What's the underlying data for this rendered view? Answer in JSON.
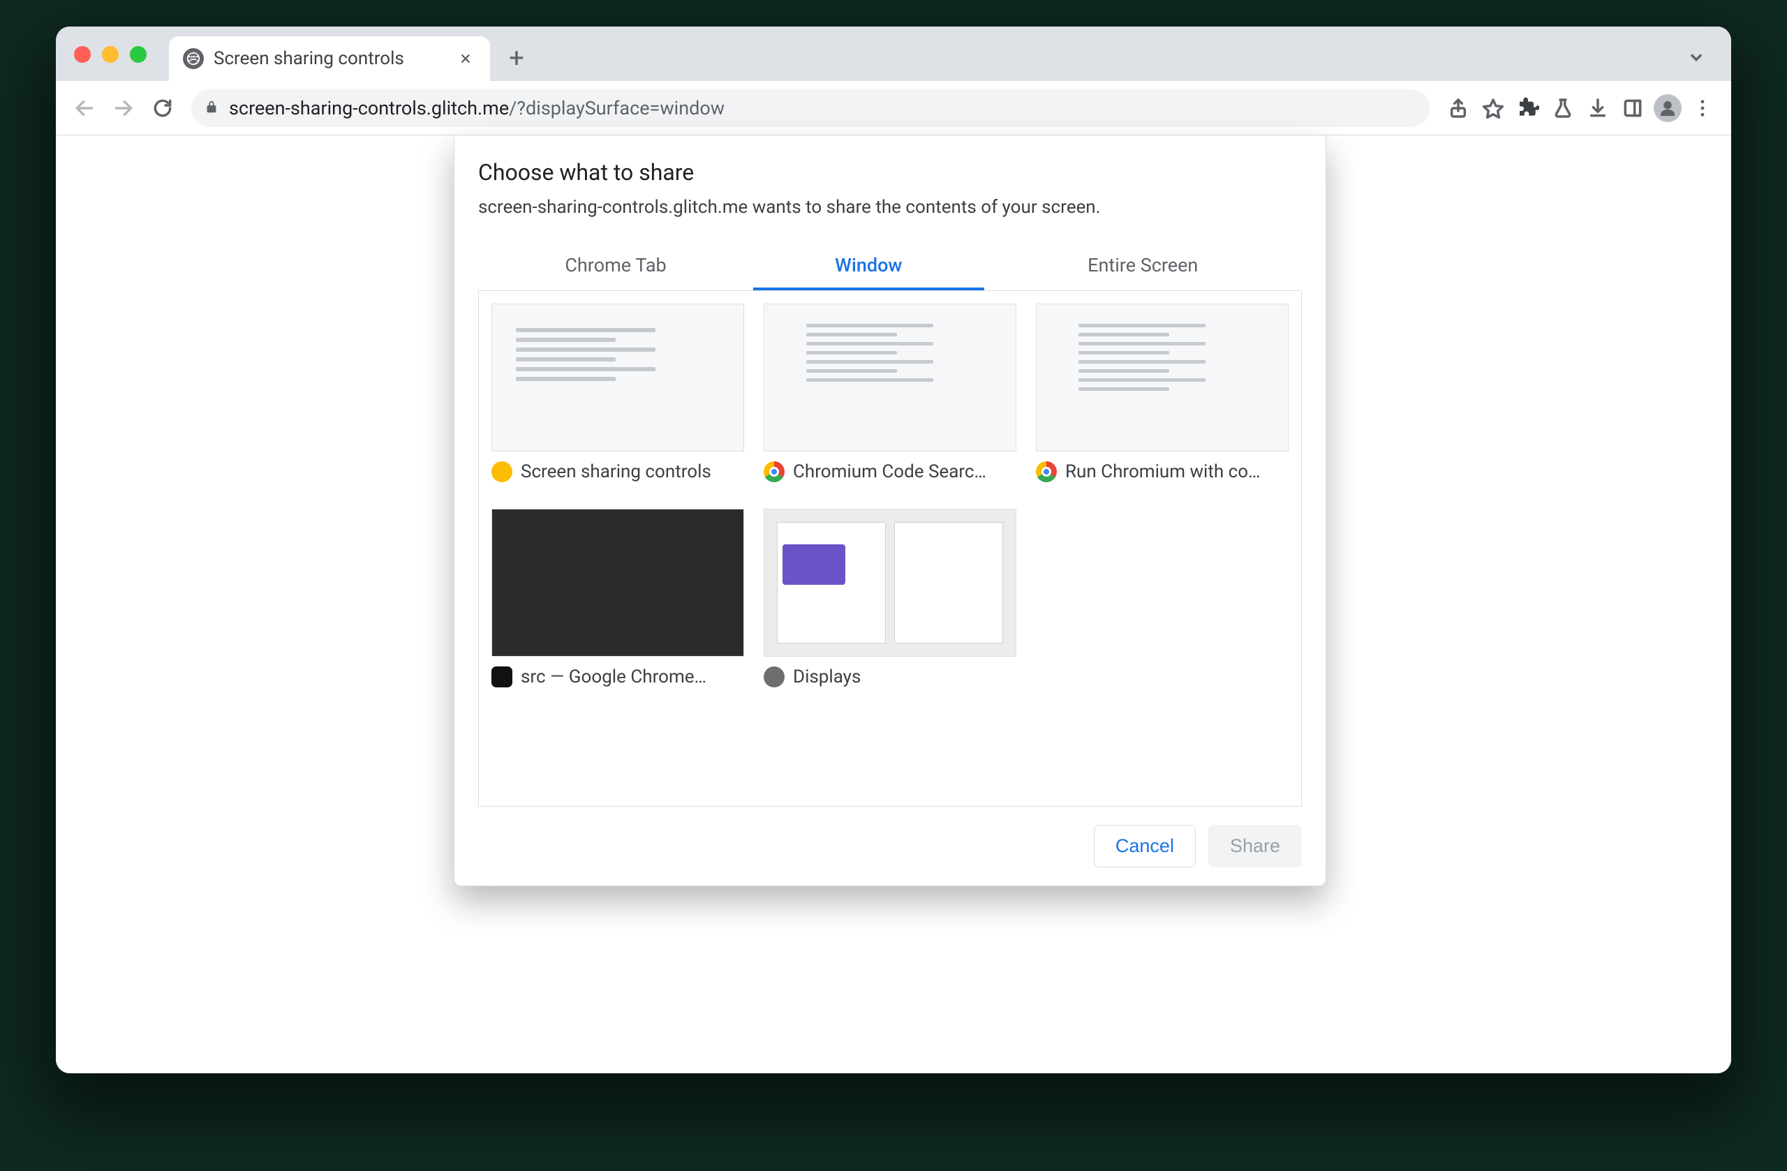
{
  "tab": {
    "title": "Screen sharing controls"
  },
  "omnibox": {
    "host": "screen-sharing-controls.glitch.me",
    "query": "/?displaySurface=window"
  },
  "dialog": {
    "title": "Choose what to share",
    "subtitle": "screen-sharing-controls.glitch.me wants to share the contents of your screen.",
    "tabs": [
      "Chrome Tab",
      "Window",
      "Entire Screen"
    ],
    "active_tab_index": 1,
    "windows": [
      {
        "label": "Screen sharing controls",
        "badge": "canary"
      },
      {
        "label": "Chromium Code Searc…",
        "badge": "chrome"
      },
      {
        "label": "Run Chromium with co…",
        "badge": "chrome"
      },
      {
        "label": "src — Google Chrome…",
        "badge": "terminal"
      },
      {
        "label": "Displays",
        "badge": "gear"
      }
    ],
    "buttons": {
      "cancel": "Cancel",
      "share": "Share"
    }
  }
}
